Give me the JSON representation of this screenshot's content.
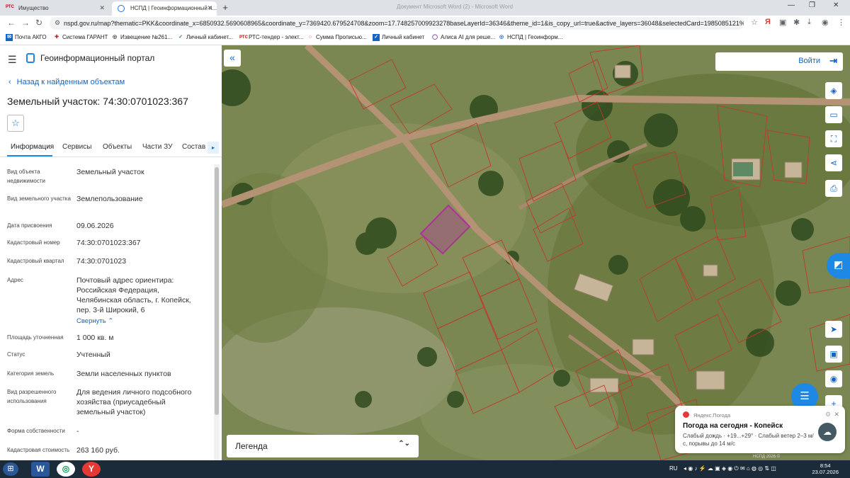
{
  "browser": {
    "tabs": [
      {
        "label": "Имущество",
        "favicon": "РТС"
      },
      {
        "label": "НСПД | Геоинформационный п..."
      }
    ],
    "window_title": "Документ Microsoft Word (2) - Microsoft Word",
    "url": "nspd.gov.ru/map?thematic=PKK&coordinate_x=6850932.5690608965&coordinate_y=7369420.679524708&zoom=17.748257009923278baseLayerId=36346&theme_id=1&is_copy_url=true&active_layers=36048&selectedCard=1985085121%2...",
    "bookmarks": [
      {
        "label": "Почта АКГО"
      },
      {
        "label": "Система ГАРАНТ"
      },
      {
        "label": "Извещение №261..."
      },
      {
        "label": "Личный кабинет..."
      },
      {
        "label": "РТС-тендер - элект..."
      },
      {
        "label": "Сумма Прописью..."
      },
      {
        "label": "Личный кабинет"
      },
      {
        "label": "Алиса AI для реше..."
      },
      {
        "label": "НСПД | Геоинформ..."
      }
    ]
  },
  "panel": {
    "portal_title": "Геоинформационный портал",
    "back_link": "Назад к найденным объектам",
    "object_title": "Земельный участок: 74:30:0701023:367",
    "tabs": [
      "Информация",
      "Сервисы",
      "Объекты",
      "Части ЗУ",
      "Состав"
    ],
    "properties": [
      {
        "label": "Вид объекта недвижимости",
        "value": "Земельный участок"
      },
      {
        "label": "Вид земельного участка",
        "value": "Землепользование"
      },
      {
        "label": "Дата присвоения",
        "value": "09.06.2026"
      },
      {
        "label": "Кадастровый номер",
        "value": "74:30:0701023:367"
      },
      {
        "label": "Кадастровый квартал",
        "value": "74:30:0701023"
      },
      {
        "label": "Адрес",
        "value": "Почтовый адрес ориентира: Российская Федерация, Челябинская область, г. Копейск, пер. 3-й Широкий, 6"
      },
      {
        "label": "Площадь уточненная",
        "value": "1 000 кв. м"
      },
      {
        "label": "Статус",
        "value": "Учтенный"
      },
      {
        "label": "Категория земель",
        "value": "Земли населенных пунктов"
      },
      {
        "label": "Вид разрешенного использования",
        "value": "Для ведения личного подсобного хозяйства (приусадебный земельный участок)"
      },
      {
        "label": "Форма собственности",
        "value": "-"
      },
      {
        "label": "Кадастровая стоимость",
        "value": "263 160 руб."
      }
    ],
    "collapse_link": "Свернуть"
  },
  "map": {
    "login_label": "Войти",
    "legend_label": "Легенда",
    "copyright": "НСПД 2026 ©"
  },
  "weather": {
    "source": "Яндекс.Погода",
    "title": "Погода на сегодня - Копейск",
    "body": "Слабый дождь · +19...+29° · Слабый ветер 2–3 м/с, порывы до 14 м/с"
  },
  "taskbar": {
    "lang": "RU",
    "time": "8:54",
    "date": "23.07.2026"
  },
  "colors": {
    "accent": "#1e88e5",
    "selected_parcel": "#b0309a",
    "parcel_outline": "#c0392b"
  }
}
